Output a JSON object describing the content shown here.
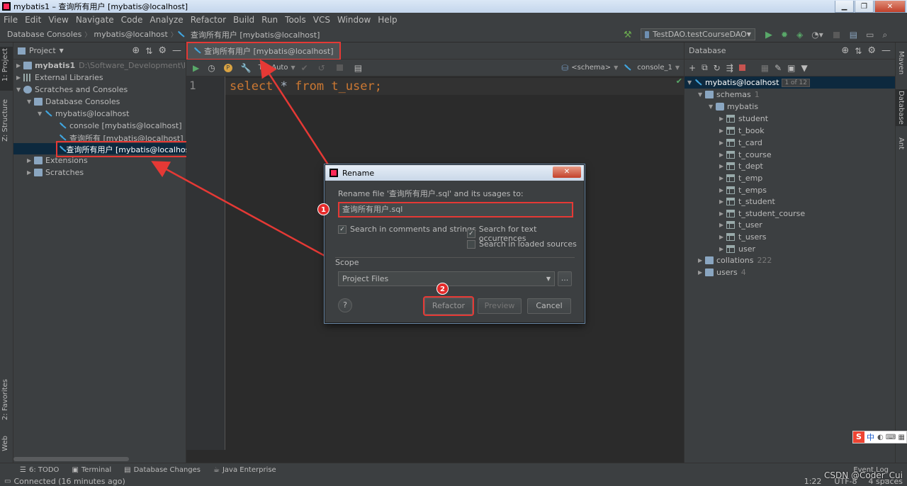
{
  "window": {
    "title": "mybatis1 – 查询所有用户 [mybatis@localhost]",
    "min": "▁",
    "max": "❐",
    "close": "✕"
  },
  "menu": [
    "File",
    "Edit",
    "View",
    "Navigate",
    "Code",
    "Analyze",
    "Refactor",
    "Build",
    "Run",
    "Tools",
    "VCS",
    "Window",
    "Help"
  ],
  "breadcrumb": [
    "Database Consoles",
    "mybatis@localhost",
    "查询所有用户 [mybatis@localhost]"
  ],
  "run_config": "TestDAO.testCourseDAO",
  "left_tools": {
    "project": "1: Project",
    "structure": "Z: Structure",
    "favorites": "2: Favorites",
    "web": "Web"
  },
  "right_tools": {
    "maven": "Maven",
    "database": "Database",
    "ant": "Ant"
  },
  "project_panel": {
    "header": "Project",
    "tree": [
      {
        "label": "mybatis1",
        "extra": "D:\\Software_Development\\IDEA_"
      },
      {
        "label": "External Libraries"
      },
      {
        "label": "Scratches and Consoles"
      },
      {
        "label": "Database Consoles"
      },
      {
        "label": "mybatis@localhost"
      },
      {
        "label": "console [mybatis@localhost]"
      },
      {
        "label": "查询所有 [mybatis@localhost]"
      },
      {
        "label": "查询所有用户 [mybatis@localhost]"
      },
      {
        "label": "Extensions"
      },
      {
        "label": "Scratches"
      }
    ]
  },
  "editor": {
    "tab": "查询所有用户 [mybatis@localhost]",
    "tx": "Tx: Auto",
    "schema": "<schema>",
    "console": "console_1",
    "line_number": "1",
    "code": {
      "kw1": "select",
      "star": " * ",
      "kw2": "from",
      "rest": " t_user;"
    }
  },
  "database_panel": {
    "header": "Database",
    "root": "mybatis@localhost",
    "root_badge": "1 of 12",
    "schemas": "schemas",
    "schemas_count": "1",
    "db": "mybatis",
    "tables": [
      "student",
      "t_book",
      "t_card",
      "t_course",
      "t_dept",
      "t_emp",
      "t_emps",
      "t_student",
      "t_student_course",
      "t_user",
      "t_users",
      "user"
    ],
    "collations": "collations",
    "collations_count": "222",
    "users": "users",
    "users_count": "4"
  },
  "dialog": {
    "title": "Rename",
    "prompt": "Rename file '查询所有用户.sql' and its usages to:",
    "value": "查询所有用户.sql",
    "opt_comments": "Search in comments and strings",
    "opt_text": "Search for text occurrences",
    "opt_loaded": "Search in loaded sources",
    "scope_label": "Scope",
    "scope_value": "Project Files",
    "browse": "...",
    "help": "?",
    "refactor": "Refactor",
    "preview": "Preview",
    "cancel": "Cancel",
    "step1": "1",
    "step2": "2"
  },
  "bottom_tools": [
    "6: TODO",
    "Terminal",
    "Database Changes",
    "Java Enterprise"
  ],
  "status": {
    "message": "Connected (16 minutes ago)",
    "position": "1:22",
    "encoding": "UTF-8",
    "indent": "4 spaces",
    "eventlog": "Event Log",
    "watermark": "CSDN @Coder_Cui"
  },
  "ime": {
    "brand": "S",
    "mode": "中"
  },
  "colors": {
    "accent": "#e53935",
    "keyword": "#cc7832",
    "selection": "#0d293e"
  }
}
